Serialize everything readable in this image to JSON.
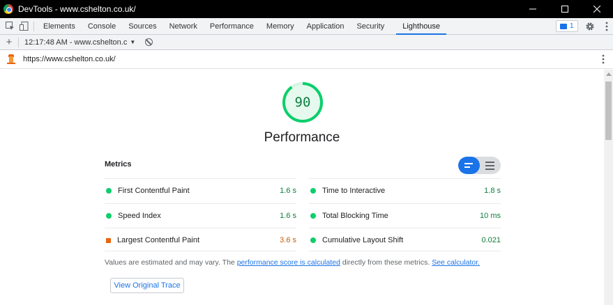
{
  "window": {
    "title": "DevTools - www.cshelton.co.uk/"
  },
  "tabs": [
    {
      "label": "Elements"
    },
    {
      "label": "Console"
    },
    {
      "label": "Sources"
    },
    {
      "label": "Network"
    },
    {
      "label": "Performance"
    },
    {
      "label": "Memory"
    },
    {
      "label": "Application"
    },
    {
      "label": "Security"
    },
    {
      "label": "Lighthouse",
      "active": true
    }
  ],
  "issues": {
    "count": "1"
  },
  "lighthouse_toolbar": {
    "report_select": "12:17:48 AM - www.cshelton.c",
    "arrow": "▼"
  },
  "url_bar": {
    "url": "https://www.cshelton.co.uk/"
  },
  "report": {
    "score": "90",
    "score_fraction": 0.9,
    "score_color": "#0cce6b",
    "category_title": "Performance",
    "metrics_header": "Metrics",
    "metrics": [
      {
        "label": "First Contentful Paint",
        "value": "1.6 s",
        "status": "pass"
      },
      {
        "label": "Time to Interactive",
        "value": "1.8 s",
        "status": "pass"
      },
      {
        "label": "Speed Index",
        "value": "1.6 s",
        "status": "pass"
      },
      {
        "label": "Total Blocking Time",
        "value": "10 ms",
        "status": "pass"
      },
      {
        "label": "Largest Contentful Paint",
        "value": "3.6 s",
        "status": "average"
      },
      {
        "label": "Cumulative Layout Shift",
        "value": "0.021",
        "status": "pass"
      }
    ],
    "disclaimer": {
      "prefix": "Values are estimated and may vary. The ",
      "link1": "performance score is calculated",
      "middle": " directly from these metrics. ",
      "link2": "See calculator."
    },
    "trace_button": "View Original Trace"
  },
  "colors": {
    "accent": "#1a73e8",
    "pass": "#0cce6b",
    "average": "#e8660d"
  }
}
